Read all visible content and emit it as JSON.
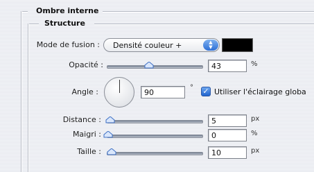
{
  "panel": {
    "section_title": "Ombre interne",
    "subsection_title": "Structure"
  },
  "blend_mode": {
    "label": "Mode de fusion :",
    "value": "Densité couleur +",
    "color": "#000000"
  },
  "opacity": {
    "label": "Opacité :",
    "value": "43",
    "unit": "%",
    "slider_fraction": 0.43
  },
  "angle": {
    "label": "Angle :",
    "value": "90",
    "unit": "°",
    "global_light_label": "Utiliser l'éclairage globa",
    "global_light_checked": true
  },
  "distance": {
    "label": "Distance :",
    "value": "5",
    "unit": "px",
    "slider_fraction": 0.02
  },
  "choke": {
    "label": "Maigri :",
    "value": "0",
    "unit": "%",
    "slider_fraction": 0.0
  },
  "size": {
    "label": "Taille :",
    "value": "10",
    "unit": "px",
    "slider_fraction": 0.04
  }
}
